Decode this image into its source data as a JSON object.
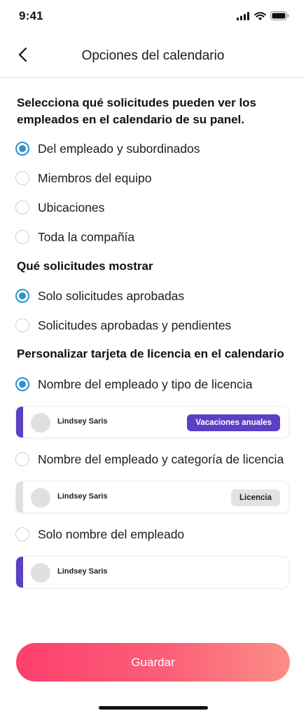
{
  "status_bar": {
    "time": "9:41",
    "icons": [
      "signal-icon",
      "wifi-icon",
      "battery-icon"
    ]
  },
  "header": {
    "title": "Opciones del calendario",
    "back_icon": "chevron-left-icon"
  },
  "visibility": {
    "title": "Selecciona qué solicitudes pueden ver los empleados en el calendario de su panel.",
    "options": [
      {
        "label": "Del empleado y subordinados",
        "selected": true
      },
      {
        "label": "Miembros del equipo",
        "selected": false
      },
      {
        "label": "Ubicaciones",
        "selected": false
      },
      {
        "label": "Toda la compañía",
        "selected": false
      }
    ]
  },
  "requests": {
    "title": "Qué solicitudes mostrar",
    "options": [
      {
        "label": "Solo solicitudes aprobadas",
        "selected": true
      },
      {
        "label": "Solicitudes aprobadas y pendientes",
        "selected": false
      }
    ]
  },
  "card_style": {
    "title": "Personalizar tarjeta de licencia en el calendario",
    "options": [
      {
        "label": "Nombre del empleado y tipo de licencia",
        "selected": true,
        "preview": {
          "name": "Lindsey Saris",
          "badge": "Vacaciones anuales",
          "stripe_color": "#5b3fc4",
          "badge_bg": "#5b3fc4",
          "badge_fg": "#ffffff"
        }
      },
      {
        "label": "Nombre del empleado y categoría de licencia",
        "selected": false,
        "preview": {
          "name": "Lindsey Saris",
          "badge": "Licencia",
          "stripe_color": "#e0e0e0",
          "badge_bg": "#e2e2e2",
          "badge_fg": "#222222"
        }
      },
      {
        "label": "Solo nombre del empleado",
        "selected": false,
        "preview": {
          "name": "Lindsey Saris",
          "stripe_color": "#5b3fc4"
        }
      }
    ]
  },
  "footer": {
    "save_label": "Guardar"
  },
  "colors": {
    "accent": "#2e93c9",
    "primary_gradient_start": "#fd3f6c",
    "primary_gradient_end": "#fb8e86"
  }
}
